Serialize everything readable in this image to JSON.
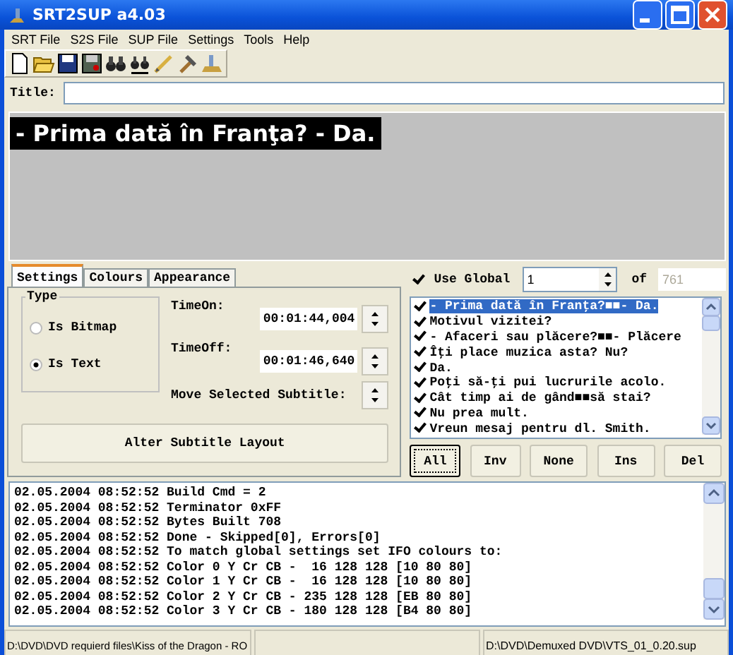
{
  "window": {
    "title": "SRT2SUP a4.03"
  },
  "menu": [
    "SRT File",
    "S2S File",
    "SUP File",
    "Settings",
    "Tools",
    "Help"
  ],
  "title_field": {
    "label": "Title:"
  },
  "preview": {
    "text": "- Prima dată în Franţa? - Da."
  },
  "tabs": [
    {
      "label": "Settings",
      "selected": true
    },
    {
      "label": "Colours",
      "selected": false
    },
    {
      "label": "Appearance",
      "selected": false
    }
  ],
  "type_group": {
    "label": "Type",
    "options": [
      {
        "label": "Is Bitmap",
        "selected": false
      },
      {
        "label": "Is Text",
        "selected": true
      }
    ]
  },
  "time_on": {
    "label": "TimeOn:",
    "value": "00:01:44,004"
  },
  "time_off": {
    "label": "TimeOff:",
    "value": "00:01:46,640"
  },
  "move_label": "Move Selected Subtitle:",
  "alter_button": "Alter Subtitle Layout",
  "use_global": {
    "label": "Use Global",
    "checked": true
  },
  "index": {
    "value": "1",
    "of_label": "of",
    "total": "761"
  },
  "subtitles": [
    {
      "text": "- Prima dată în Franţa?■■- Da.",
      "checked": true,
      "selected": true
    },
    {
      "text": "Motivul vizitei?",
      "checked": true,
      "selected": false
    },
    {
      "text": "- Afaceri sau plăcere?■■- Plăcere",
      "checked": true,
      "selected": false
    },
    {
      "text": "Îţi place muzica asta? Nu?",
      "checked": true,
      "selected": false
    },
    {
      "text": "Da.",
      "checked": true,
      "selected": false
    },
    {
      "text": "Poţi să-ţi pui lucrurile acolo.",
      "checked": true,
      "selected": false
    },
    {
      "text": "Cât timp ai de gând■■să stai?",
      "checked": true,
      "selected": false
    },
    {
      "text": "Nu prea mult.",
      "checked": true,
      "selected": false
    },
    {
      "text": "Vreun mesaj pentru dl. Smith.",
      "checked": true,
      "selected": false
    }
  ],
  "list_buttons": [
    "All",
    "Inv",
    "None",
    "Ins",
    "Del"
  ],
  "log": [
    "02.05.2004 08:52:52 Build Cmd = 2",
    "02.05.2004 08:52:52 Terminator 0xFF",
    "02.05.2004 08:52:52 Bytes Built 708",
    "02.05.2004 08:52:52 Done - Skipped[0], Errors[0]",
    "02.05.2004 08:52:52 To match global settings set IFO colours to:",
    "02.05.2004 08:52:52 Color 0 Y Cr CB -  16 128 128 [10 80 80]",
    "02.05.2004 08:52:52 Color 1 Y Cr CB -  16 128 128 [10 80 80]",
    "02.05.2004 08:52:52 Color 2 Y Cr CB - 235 128 128 [EB 80 80]",
    "02.05.2004 08:52:52 Color 3 Y Cr CB - 180 128 128 [B4 80 80]"
  ],
  "status_bar": [
    "D:\\DVD\\DVD requierd files\\Kiss of the Dragon - RO",
    "D:\\DVD\\Demuxed DVD\\VTS_01_0.20.sup"
  ]
}
